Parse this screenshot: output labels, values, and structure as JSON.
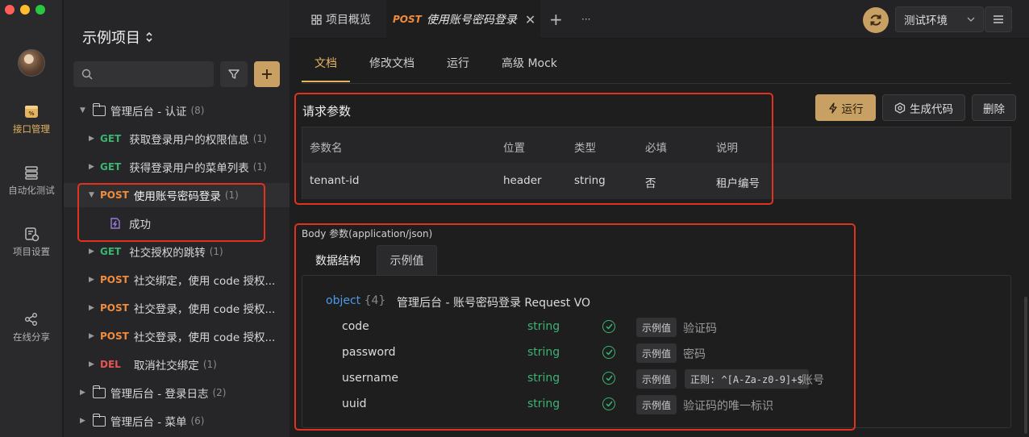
{
  "rail": {
    "items": [
      {
        "label": "接口管理"
      },
      {
        "label": "自动化测试"
      },
      {
        "label": "项目设置"
      },
      {
        "label": "在线分享"
      }
    ]
  },
  "sidebar": {
    "project_title": "示例项目",
    "search_placeholder": "",
    "tree": [
      {
        "type": "folder",
        "name": "管理后台 - 认证",
        "count": "(8)"
      },
      {
        "type": "api",
        "method": "GET",
        "name": "获取登录用户的权限信息",
        "count": "(1)"
      },
      {
        "type": "api",
        "method": "GET",
        "name": "获得登录用户的菜单列表",
        "count": "(1)"
      },
      {
        "type": "api",
        "method": "POST",
        "name": "使用账号密码登录",
        "count": "(1)"
      },
      {
        "type": "case",
        "name": "成功"
      },
      {
        "type": "api",
        "method": "GET",
        "name": "社交授权的跳转",
        "count": "(1)"
      },
      {
        "type": "api",
        "method": "POST",
        "name": "社交绑定，使用 code 授权..."
      },
      {
        "type": "api",
        "method": "POST",
        "name": "社交登录，使用 code 授权..."
      },
      {
        "type": "api",
        "method": "POST",
        "name": "社交登录，使用 code 授权..."
      },
      {
        "type": "api",
        "method": "DEL",
        "name": "取消社交绑定",
        "count": "(1)"
      },
      {
        "type": "folder",
        "name": "管理后台 - 登录日志",
        "count": "(2)"
      },
      {
        "type": "folder",
        "name": "管理后台 - 菜单",
        "count": "(6)"
      }
    ]
  },
  "topbar": {
    "overview_tab": "项目概览",
    "active_tab_method": "POST",
    "active_tab_title": "使用账号密码登录",
    "add_tab": "+",
    "more_tabs": "···",
    "env": "测试环境"
  },
  "subtabs": [
    "文档",
    "修改文档",
    "运行",
    "高级 Mock"
  ],
  "actions": {
    "run": "运行",
    "gen_code": "生成代码",
    "delete": "删除"
  },
  "request_params": {
    "title": "请求参数",
    "headers": [
      "参数名",
      "位置",
      "类型",
      "必填",
      "说明"
    ],
    "rows": [
      [
        "tenant-id",
        "header",
        "string",
        "否",
        "租户编号"
      ]
    ]
  },
  "body": {
    "label": "Body 参数(application/json)",
    "tabs": [
      "数据结构",
      "示例值"
    ],
    "root_type": "object",
    "root_count": "{4}",
    "root_desc": "管理后台 - 账号密码登录 Request VO",
    "fields": [
      {
        "name": "code",
        "type": "string",
        "badge": "示例值",
        "desc": "验证码"
      },
      {
        "name": "password",
        "type": "string",
        "badge": "示例值",
        "desc": "密码"
      },
      {
        "name": "username",
        "type": "string",
        "badge": "示例值",
        "regex": "正则: ^[A-Za-z0-9]+$",
        "desc": "账号"
      },
      {
        "name": "uuid",
        "type": "string",
        "badge": "示例值",
        "desc": "验证码的唯一标识"
      }
    ]
  },
  "colors": {
    "accent": "#c8a064",
    "get": "#3cb371",
    "post": "#f08c3c",
    "del": "#e85454",
    "highlight_box": "#e0321e"
  }
}
